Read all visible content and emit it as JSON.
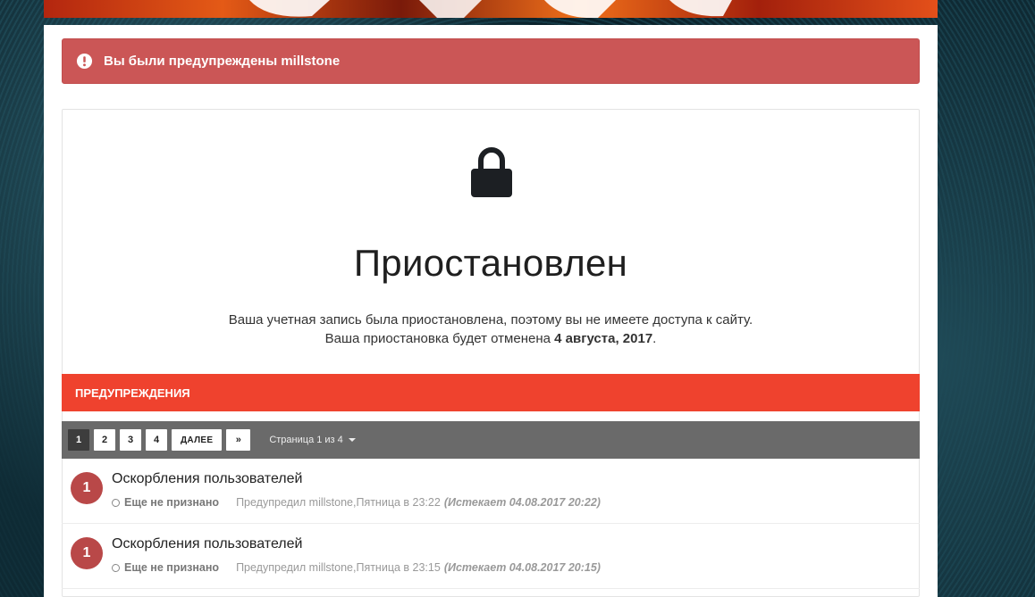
{
  "alert": {
    "text": "Вы были предупреждены millstone",
    "icon": "exclamation-circle-icon"
  },
  "suspended": {
    "icon": "lock-icon",
    "title": "Приостановлен",
    "message_line1": "Ваша учетная запись была приостановлена, поэтому вы не имеете доступа к сайту.",
    "message_line2_prefix": "Ваша приостановка будет отменена ",
    "message_line2_date": "4 августа, 2017",
    "message_line2_suffix": "."
  },
  "warnings_header": "ПРЕДУПРЕЖДЕНИЯ",
  "pagination": {
    "pages": [
      "1",
      "2",
      "3",
      "4"
    ],
    "active": "1",
    "next_label": "ДАЛЕЕ",
    "last_symbol": "»",
    "page_info": "Страница 1 из 4"
  },
  "warnings": [
    {
      "points": "1",
      "title": "Оскорбления пользователей",
      "status": "Еще не признано",
      "issued": "Предупредил millstone,Пятница в 23:22",
      "expires": "(Истекает 04.08.2017 20:22)"
    },
    {
      "points": "1",
      "title": "Оскорбления пользователей",
      "status": "Еще не признано",
      "issued": "Предупредил millstone,Пятница в 23:15",
      "expires": "(Истекает 04.08.2017 20:15)"
    }
  ],
  "colors": {
    "alert_bg": "#cb5656",
    "warn_header_bg": "#ef422e",
    "pagination_bg": "#6a6a6a",
    "badge_bg": "#b94848"
  }
}
